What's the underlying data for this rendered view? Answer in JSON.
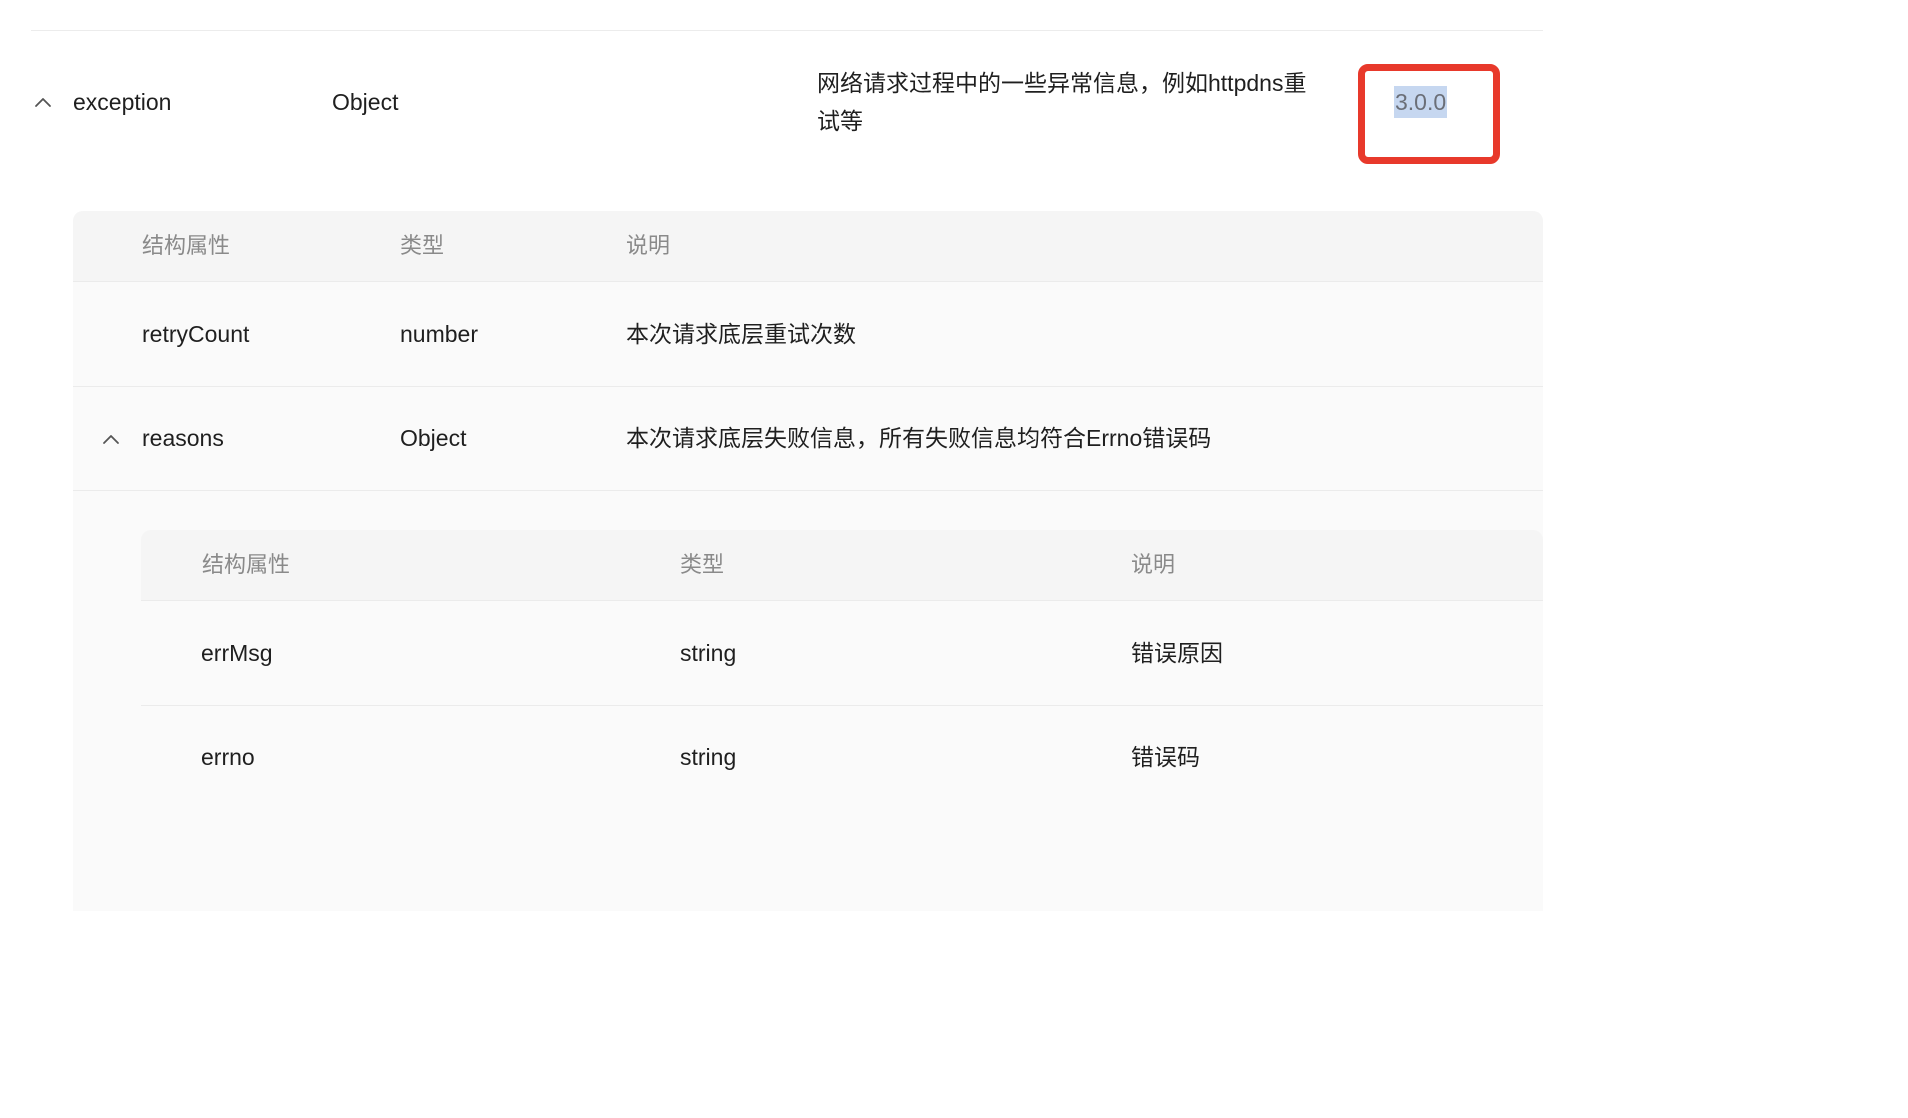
{
  "exception_row": {
    "name": "exception",
    "type": "Object",
    "description": "网络请求过程中的一些异常信息，例如httpdns重试等",
    "version": "3.0.0"
  },
  "nested_table": {
    "headers": {
      "property": "结构属性",
      "type": "类型",
      "description": "说明"
    },
    "rows": [
      {
        "name": "retryCount",
        "type": "number",
        "description": "本次请求底层重试次数"
      },
      {
        "name": "reasons",
        "type": "Object",
        "description": "本次请求底层失败信息，所有失败信息均符合Errno错误码"
      }
    ]
  },
  "reasons_table": {
    "headers": {
      "property": "结构属性",
      "type": "类型",
      "description": "说明"
    },
    "rows": [
      {
        "name": "errMsg",
        "type": "string",
        "description": "错误原因"
      },
      {
        "name": "errno",
        "type": "string",
        "description": "错误码"
      }
    ]
  },
  "colors": {
    "highlight_border": "#e8392b",
    "selection": "#c6d7f0",
    "header_text": "#8a8a8a",
    "panel_bg": "#fafafa"
  },
  "icons": {
    "expand_toggle": "chevron-up-icon"
  }
}
